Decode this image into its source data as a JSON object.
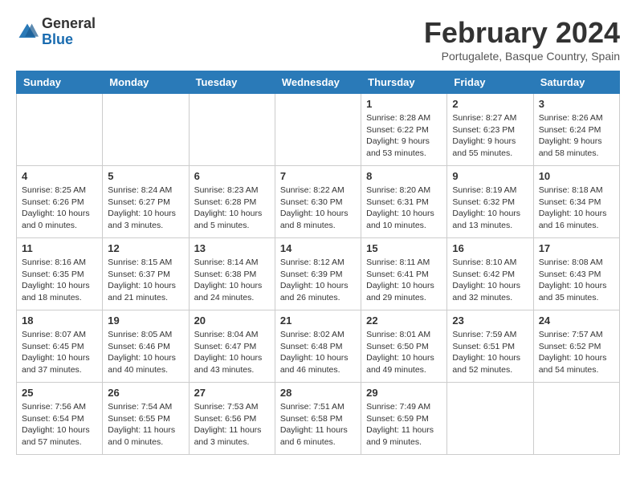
{
  "logo": {
    "general": "General",
    "blue": "Blue"
  },
  "title": "February 2024",
  "location": "Portugalete, Basque Country, Spain",
  "days_of_week": [
    "Sunday",
    "Monday",
    "Tuesday",
    "Wednesday",
    "Thursday",
    "Friday",
    "Saturday"
  ],
  "weeks": [
    [
      {
        "day": "",
        "info": ""
      },
      {
        "day": "",
        "info": ""
      },
      {
        "day": "",
        "info": ""
      },
      {
        "day": "",
        "info": ""
      },
      {
        "day": "1",
        "info": "Sunrise: 8:28 AM\nSunset: 6:22 PM\nDaylight: 9 hours\nand 53 minutes."
      },
      {
        "day": "2",
        "info": "Sunrise: 8:27 AM\nSunset: 6:23 PM\nDaylight: 9 hours\nand 55 minutes."
      },
      {
        "day": "3",
        "info": "Sunrise: 8:26 AM\nSunset: 6:24 PM\nDaylight: 9 hours\nand 58 minutes."
      }
    ],
    [
      {
        "day": "4",
        "info": "Sunrise: 8:25 AM\nSunset: 6:26 PM\nDaylight: 10 hours\nand 0 minutes."
      },
      {
        "day": "5",
        "info": "Sunrise: 8:24 AM\nSunset: 6:27 PM\nDaylight: 10 hours\nand 3 minutes."
      },
      {
        "day": "6",
        "info": "Sunrise: 8:23 AM\nSunset: 6:28 PM\nDaylight: 10 hours\nand 5 minutes."
      },
      {
        "day": "7",
        "info": "Sunrise: 8:22 AM\nSunset: 6:30 PM\nDaylight: 10 hours\nand 8 minutes."
      },
      {
        "day": "8",
        "info": "Sunrise: 8:20 AM\nSunset: 6:31 PM\nDaylight: 10 hours\nand 10 minutes."
      },
      {
        "day": "9",
        "info": "Sunrise: 8:19 AM\nSunset: 6:32 PM\nDaylight: 10 hours\nand 13 minutes."
      },
      {
        "day": "10",
        "info": "Sunrise: 8:18 AM\nSunset: 6:34 PM\nDaylight: 10 hours\nand 16 minutes."
      }
    ],
    [
      {
        "day": "11",
        "info": "Sunrise: 8:16 AM\nSunset: 6:35 PM\nDaylight: 10 hours\nand 18 minutes."
      },
      {
        "day": "12",
        "info": "Sunrise: 8:15 AM\nSunset: 6:37 PM\nDaylight: 10 hours\nand 21 minutes."
      },
      {
        "day": "13",
        "info": "Sunrise: 8:14 AM\nSunset: 6:38 PM\nDaylight: 10 hours\nand 24 minutes."
      },
      {
        "day": "14",
        "info": "Sunrise: 8:12 AM\nSunset: 6:39 PM\nDaylight: 10 hours\nand 26 minutes."
      },
      {
        "day": "15",
        "info": "Sunrise: 8:11 AM\nSunset: 6:41 PM\nDaylight: 10 hours\nand 29 minutes."
      },
      {
        "day": "16",
        "info": "Sunrise: 8:10 AM\nSunset: 6:42 PM\nDaylight: 10 hours\nand 32 minutes."
      },
      {
        "day": "17",
        "info": "Sunrise: 8:08 AM\nSunset: 6:43 PM\nDaylight: 10 hours\nand 35 minutes."
      }
    ],
    [
      {
        "day": "18",
        "info": "Sunrise: 8:07 AM\nSunset: 6:45 PM\nDaylight: 10 hours\nand 37 minutes."
      },
      {
        "day": "19",
        "info": "Sunrise: 8:05 AM\nSunset: 6:46 PM\nDaylight: 10 hours\nand 40 minutes."
      },
      {
        "day": "20",
        "info": "Sunrise: 8:04 AM\nSunset: 6:47 PM\nDaylight: 10 hours\nand 43 minutes."
      },
      {
        "day": "21",
        "info": "Sunrise: 8:02 AM\nSunset: 6:48 PM\nDaylight: 10 hours\nand 46 minutes."
      },
      {
        "day": "22",
        "info": "Sunrise: 8:01 AM\nSunset: 6:50 PM\nDaylight: 10 hours\nand 49 minutes."
      },
      {
        "day": "23",
        "info": "Sunrise: 7:59 AM\nSunset: 6:51 PM\nDaylight: 10 hours\nand 52 minutes."
      },
      {
        "day": "24",
        "info": "Sunrise: 7:57 AM\nSunset: 6:52 PM\nDaylight: 10 hours\nand 54 minutes."
      }
    ],
    [
      {
        "day": "25",
        "info": "Sunrise: 7:56 AM\nSunset: 6:54 PM\nDaylight: 10 hours\nand 57 minutes."
      },
      {
        "day": "26",
        "info": "Sunrise: 7:54 AM\nSunset: 6:55 PM\nDaylight: 11 hours\nand 0 minutes."
      },
      {
        "day": "27",
        "info": "Sunrise: 7:53 AM\nSunset: 6:56 PM\nDaylight: 11 hours\nand 3 minutes."
      },
      {
        "day": "28",
        "info": "Sunrise: 7:51 AM\nSunset: 6:58 PM\nDaylight: 11 hours\nand 6 minutes."
      },
      {
        "day": "29",
        "info": "Sunrise: 7:49 AM\nSunset: 6:59 PM\nDaylight: 11 hours\nand 9 minutes."
      },
      {
        "day": "",
        "info": ""
      },
      {
        "day": "",
        "info": ""
      }
    ]
  ]
}
